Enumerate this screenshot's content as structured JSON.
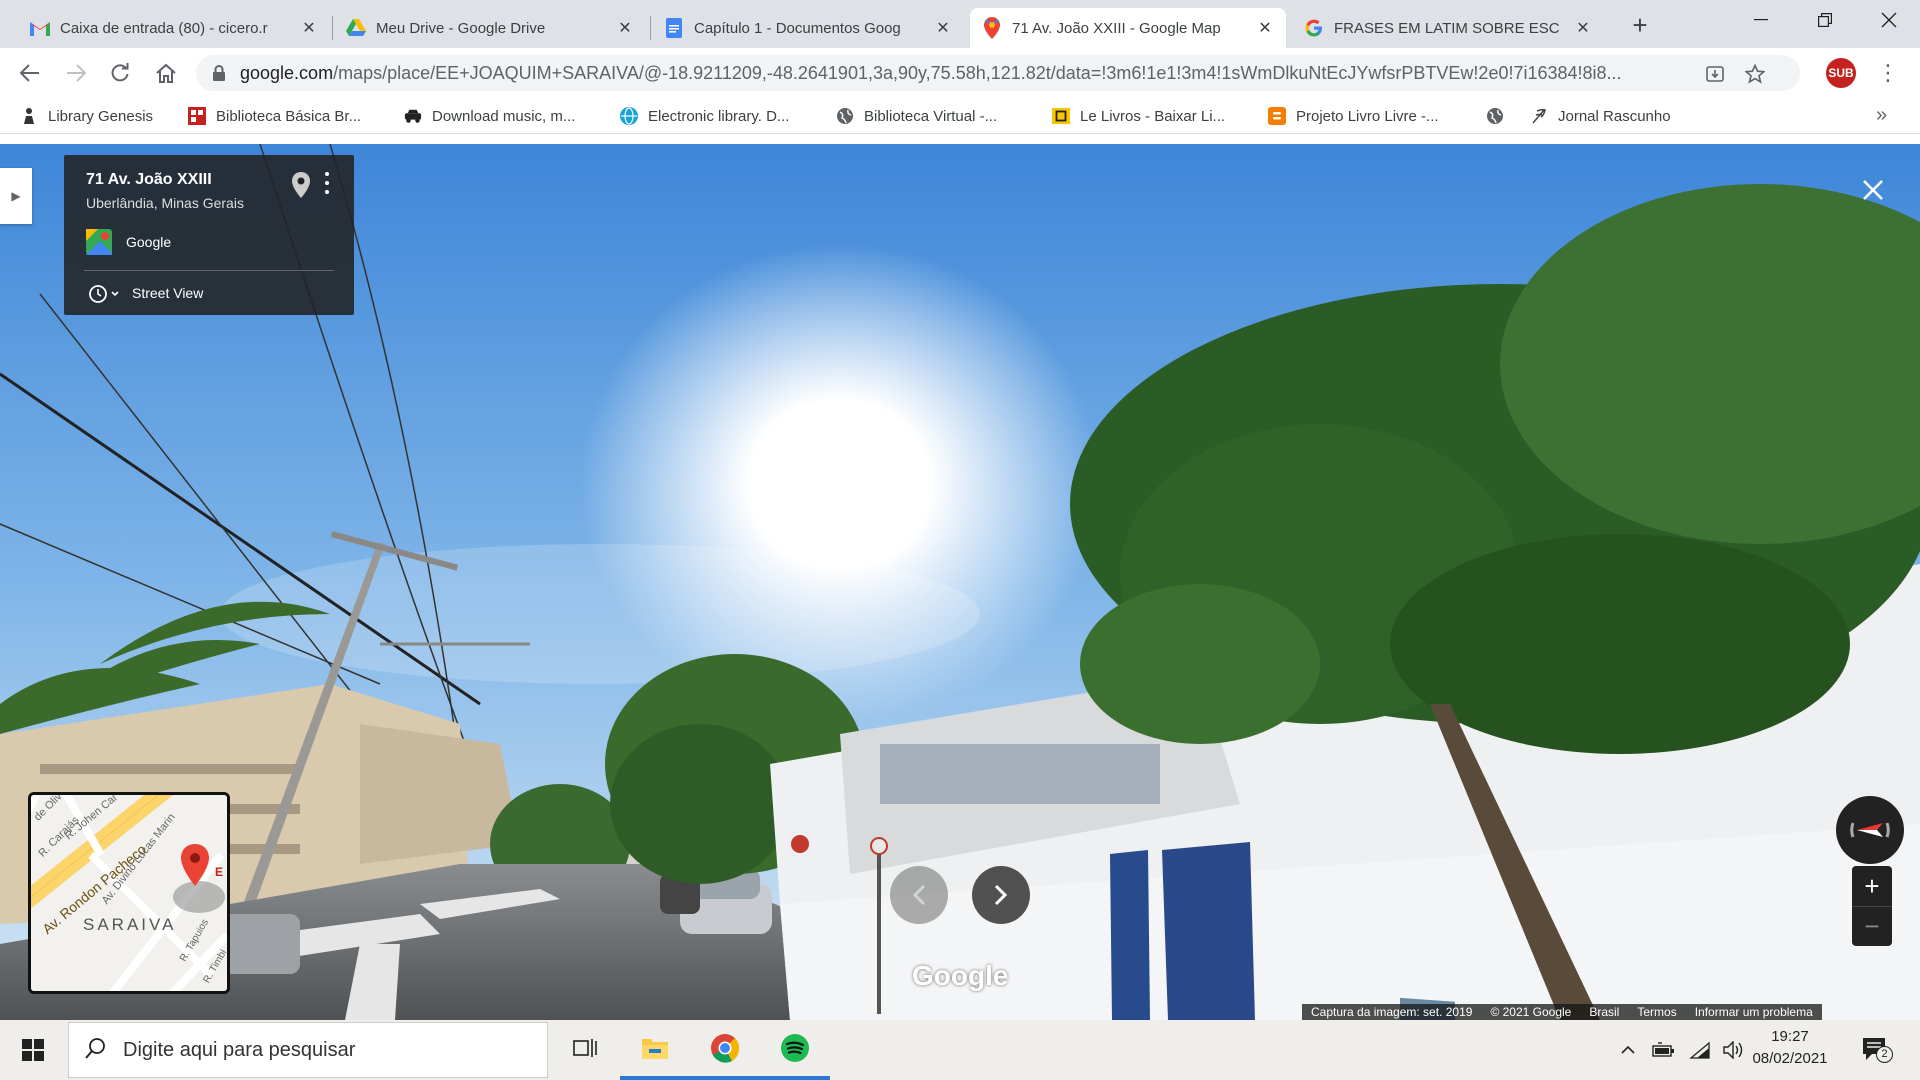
{
  "browser": {
    "tabs": [
      {
        "title": "Caixa de entrada (80) - cicero.r",
        "favicon": "gmail-icon"
      },
      {
        "title": "Meu Drive - Google Drive",
        "favicon": "google-drive-icon"
      },
      {
        "title": "Capítulo 1 - Documentos Goog",
        "favicon": "google-docs-icon"
      },
      {
        "title": "71 Av. João XXIII - Google Map",
        "favicon": "google-maps-icon",
        "active": true
      },
      {
        "title": "FRASES EM LATIM SOBRE ESC",
        "favicon": "google-icon"
      }
    ],
    "url_host": "google.com",
    "url_rest": "/maps/place/EE+JOAQUIM+SARAIVA/@-18.9211209,-48.2641901,3a,90y,75.58h,121.82t/data=!3m6!1e1!3m4!1sWmDlkuNtEcJYwfsrPBTVEw!2e0!7i16384!8i8...",
    "profile_initials": "SUB",
    "bookmarks": [
      {
        "label": "Library Genesis",
        "icon": "person-icon"
      },
      {
        "label": "Biblioteca Básica Br...",
        "icon": "bbm-icon"
      },
      {
        "label": "Download music, m...",
        "icon": "car-icon"
      },
      {
        "label": "Electronic library. D...",
        "icon": "globe-icon"
      },
      {
        "label": "Biblioteca Virtual -...",
        "icon": "world-icon"
      },
      {
        "label": "Le Livros - Baixar Li...",
        "icon": "book-icon"
      },
      {
        "label": "Projeto Livro Livre -...",
        "icon": "blogger-icon"
      },
      {
        "label": "",
        "icon": "world-icon"
      },
      {
        "label": "Jornal Rascunho",
        "icon": "feather-icon"
      }
    ]
  },
  "streetview": {
    "address": "71 Av. João XXIII",
    "city": "Uberlândia, Minas Gerais",
    "source": "Google",
    "mode_label": "Street View",
    "watermark": "Google",
    "footer": [
      "Captura da imagem: set. 2019",
      "© 2021 Google",
      "Brasil",
      "Termos",
      "Informar um problema"
    ],
    "minimap": {
      "district": "SARAIVA",
      "streets": [
        "Av. Rondon Pacheco",
        "R. Johen Car",
        "de Oliv",
        "R. Carajás",
        "Av. Divino Lucas Marin",
        "R. Tapuios",
        "R. Timbi"
      ],
      "label_fragment": "E"
    }
  },
  "taskbar": {
    "search_placeholder": "Digite aqui para pesquisar",
    "time": "19:27",
    "date": "08/02/2021",
    "notification_count": "2"
  },
  "colors": {
    "accent": "#1a73e8",
    "maps_pin": "#ea4335",
    "taskbar_active": "#2b78d6"
  }
}
